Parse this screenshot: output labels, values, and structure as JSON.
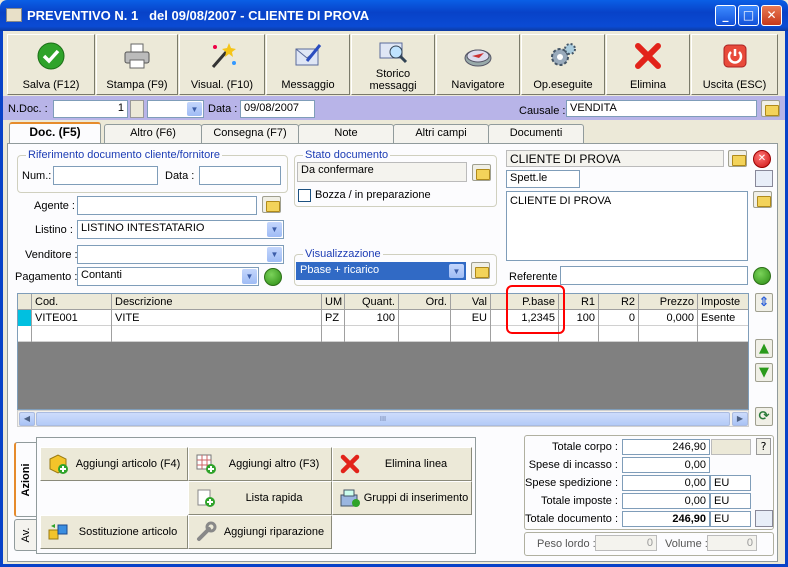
{
  "window": {
    "title": "PREVENTIVO N. 1   del 09/08/2007 - CLIENTE DI PROVA",
    "min": "_",
    "max": "□",
    "close": "✕"
  },
  "toolbar": [
    {
      "label": "Salva (F12)",
      "icon": "save-check-icon"
    },
    {
      "label": "Stampa (F9)",
      "icon": "printer-icon"
    },
    {
      "label": "Visual. (F10)",
      "icon": "magic-wand-icon"
    },
    {
      "label": "Messaggio",
      "icon": "envelope-pen-icon"
    },
    {
      "label": "Storico\nmessaggi",
      "icon": "envelope-search-icon"
    },
    {
      "label": "Navigatore",
      "icon": "compass-icon"
    },
    {
      "label": "Op.eseguite",
      "icon": "gears-icon"
    },
    {
      "label": "Elimina",
      "icon": "red-x-icon"
    },
    {
      "label": "Uscita (ESC)",
      "icon": "power-icon"
    }
  ],
  "header": {
    "ndoc_label": "N.Doc. :",
    "ndoc_value": "1",
    "data_label": "Data :",
    "data_value": "09/08/2007",
    "causale_label": "Causale :",
    "causale_value": "VENDITA"
  },
  "tabs": [
    "Doc. (F5)",
    "Altro (F6)",
    "Consegna (F7)",
    "Note",
    "Altri campi",
    "Documenti"
  ],
  "riferimento": {
    "title": "Riferimento documento cliente/fornitore",
    "num_label": "Num.:",
    "num_value": "",
    "data_label": "Data :",
    "data_value": ""
  },
  "stato": {
    "title": "Stato documento",
    "value": "Da confermare",
    "bozza_label": "Bozza / in preparazione"
  },
  "cliente": {
    "name": "CLIENTE DI PROVA",
    "spett": "Spett.le",
    "address": "CLIENTE DI PROVA",
    "referente_label": "Referente",
    "referente_value": ""
  },
  "fields": {
    "agente_label": "Agente :",
    "agente_value": "",
    "listino_label": "Listino :",
    "listino_value": "LISTINO INTESTATARIO",
    "venditore_label": "Venditore :",
    "venditore_value": "",
    "pagamento_label": "Pagamento :",
    "pagamento_value": "Contanti"
  },
  "visualizzazione": {
    "title": "Visualizzazione",
    "value": "Pbase + ricarico"
  },
  "grid": {
    "columns": [
      "Cod.",
      "Descrizione",
      "UM",
      "Quant.",
      "Ord.",
      "Val",
      "P.base",
      "R1",
      "R2",
      "Prezzo",
      "Imposte"
    ],
    "rows": [
      [
        "VITE001",
        "VITE",
        "PZ",
        "100",
        "",
        "EU",
        "1,2345",
        "100",
        "0",
        "0,000",
        "Esente"
      ]
    ]
  },
  "scroll_mid": "III",
  "actions": {
    "tab_azioni": "Azioni",
    "tab_av": "Av.",
    "buttons": [
      "Aggiungi articolo (F4)",
      "Aggiungi altro (F3)",
      "Elimina linea",
      "Lista rapida",
      "Gruppi di inserimento",
      "Sostituzione articolo",
      "Aggiungi riparazione"
    ]
  },
  "totals": {
    "corpo_label": "Totale corpo :",
    "corpo_value": "246,90",
    "help": "?",
    "incasso_label": "Spese di incasso :",
    "incasso_value": "0,00",
    "spedizione_label": "Spese spedizione :",
    "spedizione_value": "0,00",
    "spedizione_cur": "EU",
    "imposte_label": "Totale imposte :",
    "imposte_value": "0,00",
    "imposte_cur": "EU",
    "documento_label": "Totale documento :",
    "documento_value": "246,90",
    "documento_cur": "EU",
    "peso_label": "Peso lordo :",
    "peso_value": "0",
    "volume_label": "Volume :",
    "volume_value": "0"
  },
  "colors": {
    "highlight": "#ff0000",
    "selection": "#316ac5",
    "purple_bar": "#b8b4e8"
  }
}
